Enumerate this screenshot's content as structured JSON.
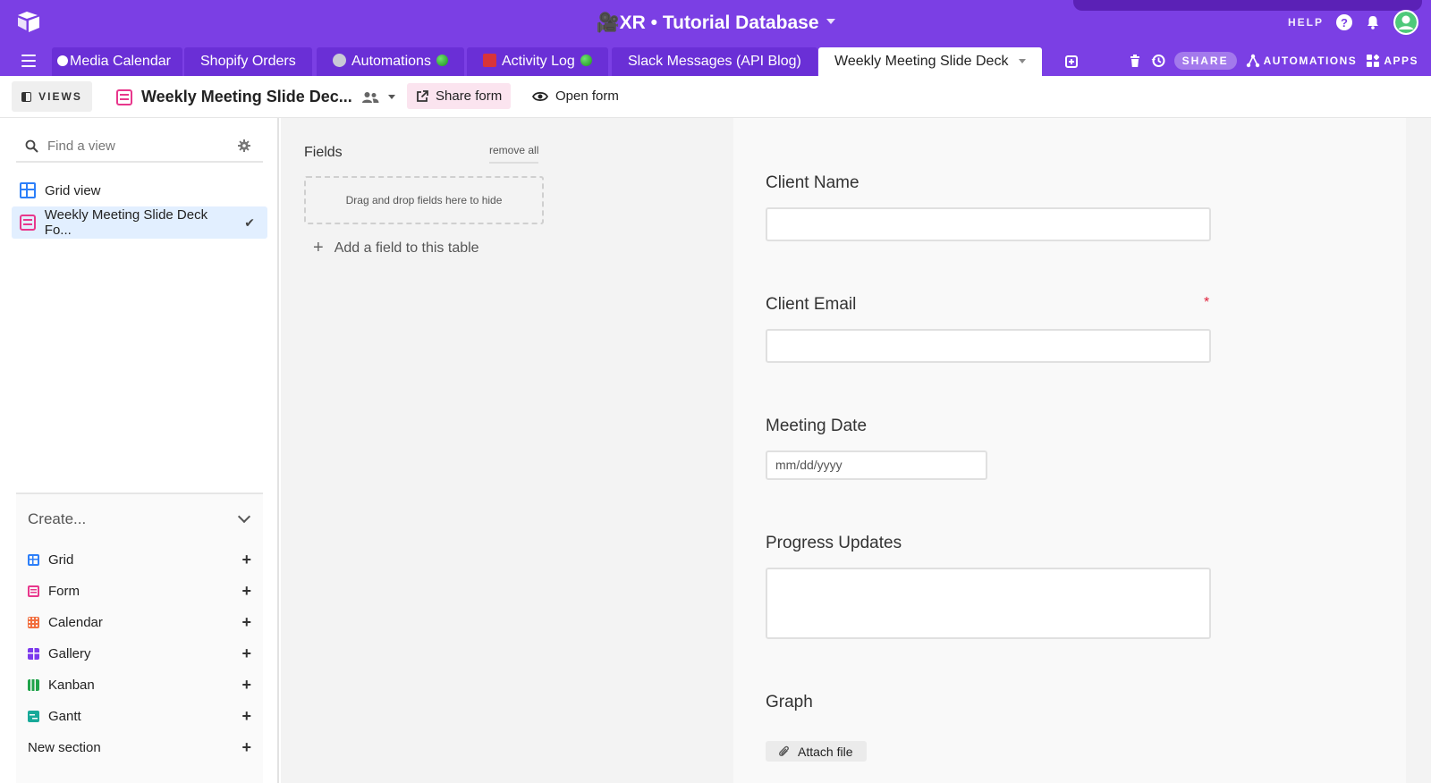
{
  "header": {
    "base_title": "🎥XR • Tutorial Database",
    "help_label": "HELP"
  },
  "tabs": [
    {
      "label": "Media Calendar"
    },
    {
      "label": "Shopify Orders"
    },
    {
      "label": "Automations"
    },
    {
      "label": "Activity Log"
    },
    {
      "label": "Slack Messages (API Blog)"
    },
    {
      "label": "Weekly Meeting Slide Deck"
    }
  ],
  "tabs_right": {
    "share_label": "SHARE",
    "automations_label": "AUTOMATIONS",
    "apps_label": "APPS"
  },
  "viewbar": {
    "views_label": "VIEWS",
    "view_name": "Weekly Meeting Slide Dec...",
    "share_form_label": "Share form",
    "open_form_label": "Open form"
  },
  "sidebar": {
    "search_placeholder": "Find a view",
    "views": [
      {
        "label": "Grid view"
      },
      {
        "label": "Weekly Meeting Slide Deck Fo..."
      }
    ],
    "create_title": "Create...",
    "create_items": [
      {
        "label": "Grid",
        "color": "#2d7ff9"
      },
      {
        "label": "Form",
        "color": "#e8378c"
      },
      {
        "label": "Calendar",
        "color": "#f26d3d"
      },
      {
        "label": "Gallery",
        "color": "#7c3aed"
      },
      {
        "label": "Kanban",
        "color": "#20a34a"
      },
      {
        "label": "Gantt",
        "color": "#18a999"
      },
      {
        "label": "New section",
        "color": ""
      }
    ]
  },
  "fields_panel": {
    "title": "Fields",
    "remove_all": "remove all",
    "drop_hint": "Drag and drop fields here to hide",
    "add_field": "Add a field to this table"
  },
  "form": {
    "fields": [
      {
        "label": "Client Name"
      },
      {
        "label": "Client Email",
        "required_mark": "*"
      },
      {
        "label": "Meeting Date",
        "placeholder": "mm/dd/yyyy"
      },
      {
        "label": "Progress Updates"
      },
      {
        "label": "Graph",
        "button": "Attach file"
      }
    ]
  },
  "colors": {
    "brand": "#7b3fe4",
    "active_view_bg": "#e2efff",
    "share_form_bg": "#fbe4ef",
    "required": "#e0203a"
  }
}
